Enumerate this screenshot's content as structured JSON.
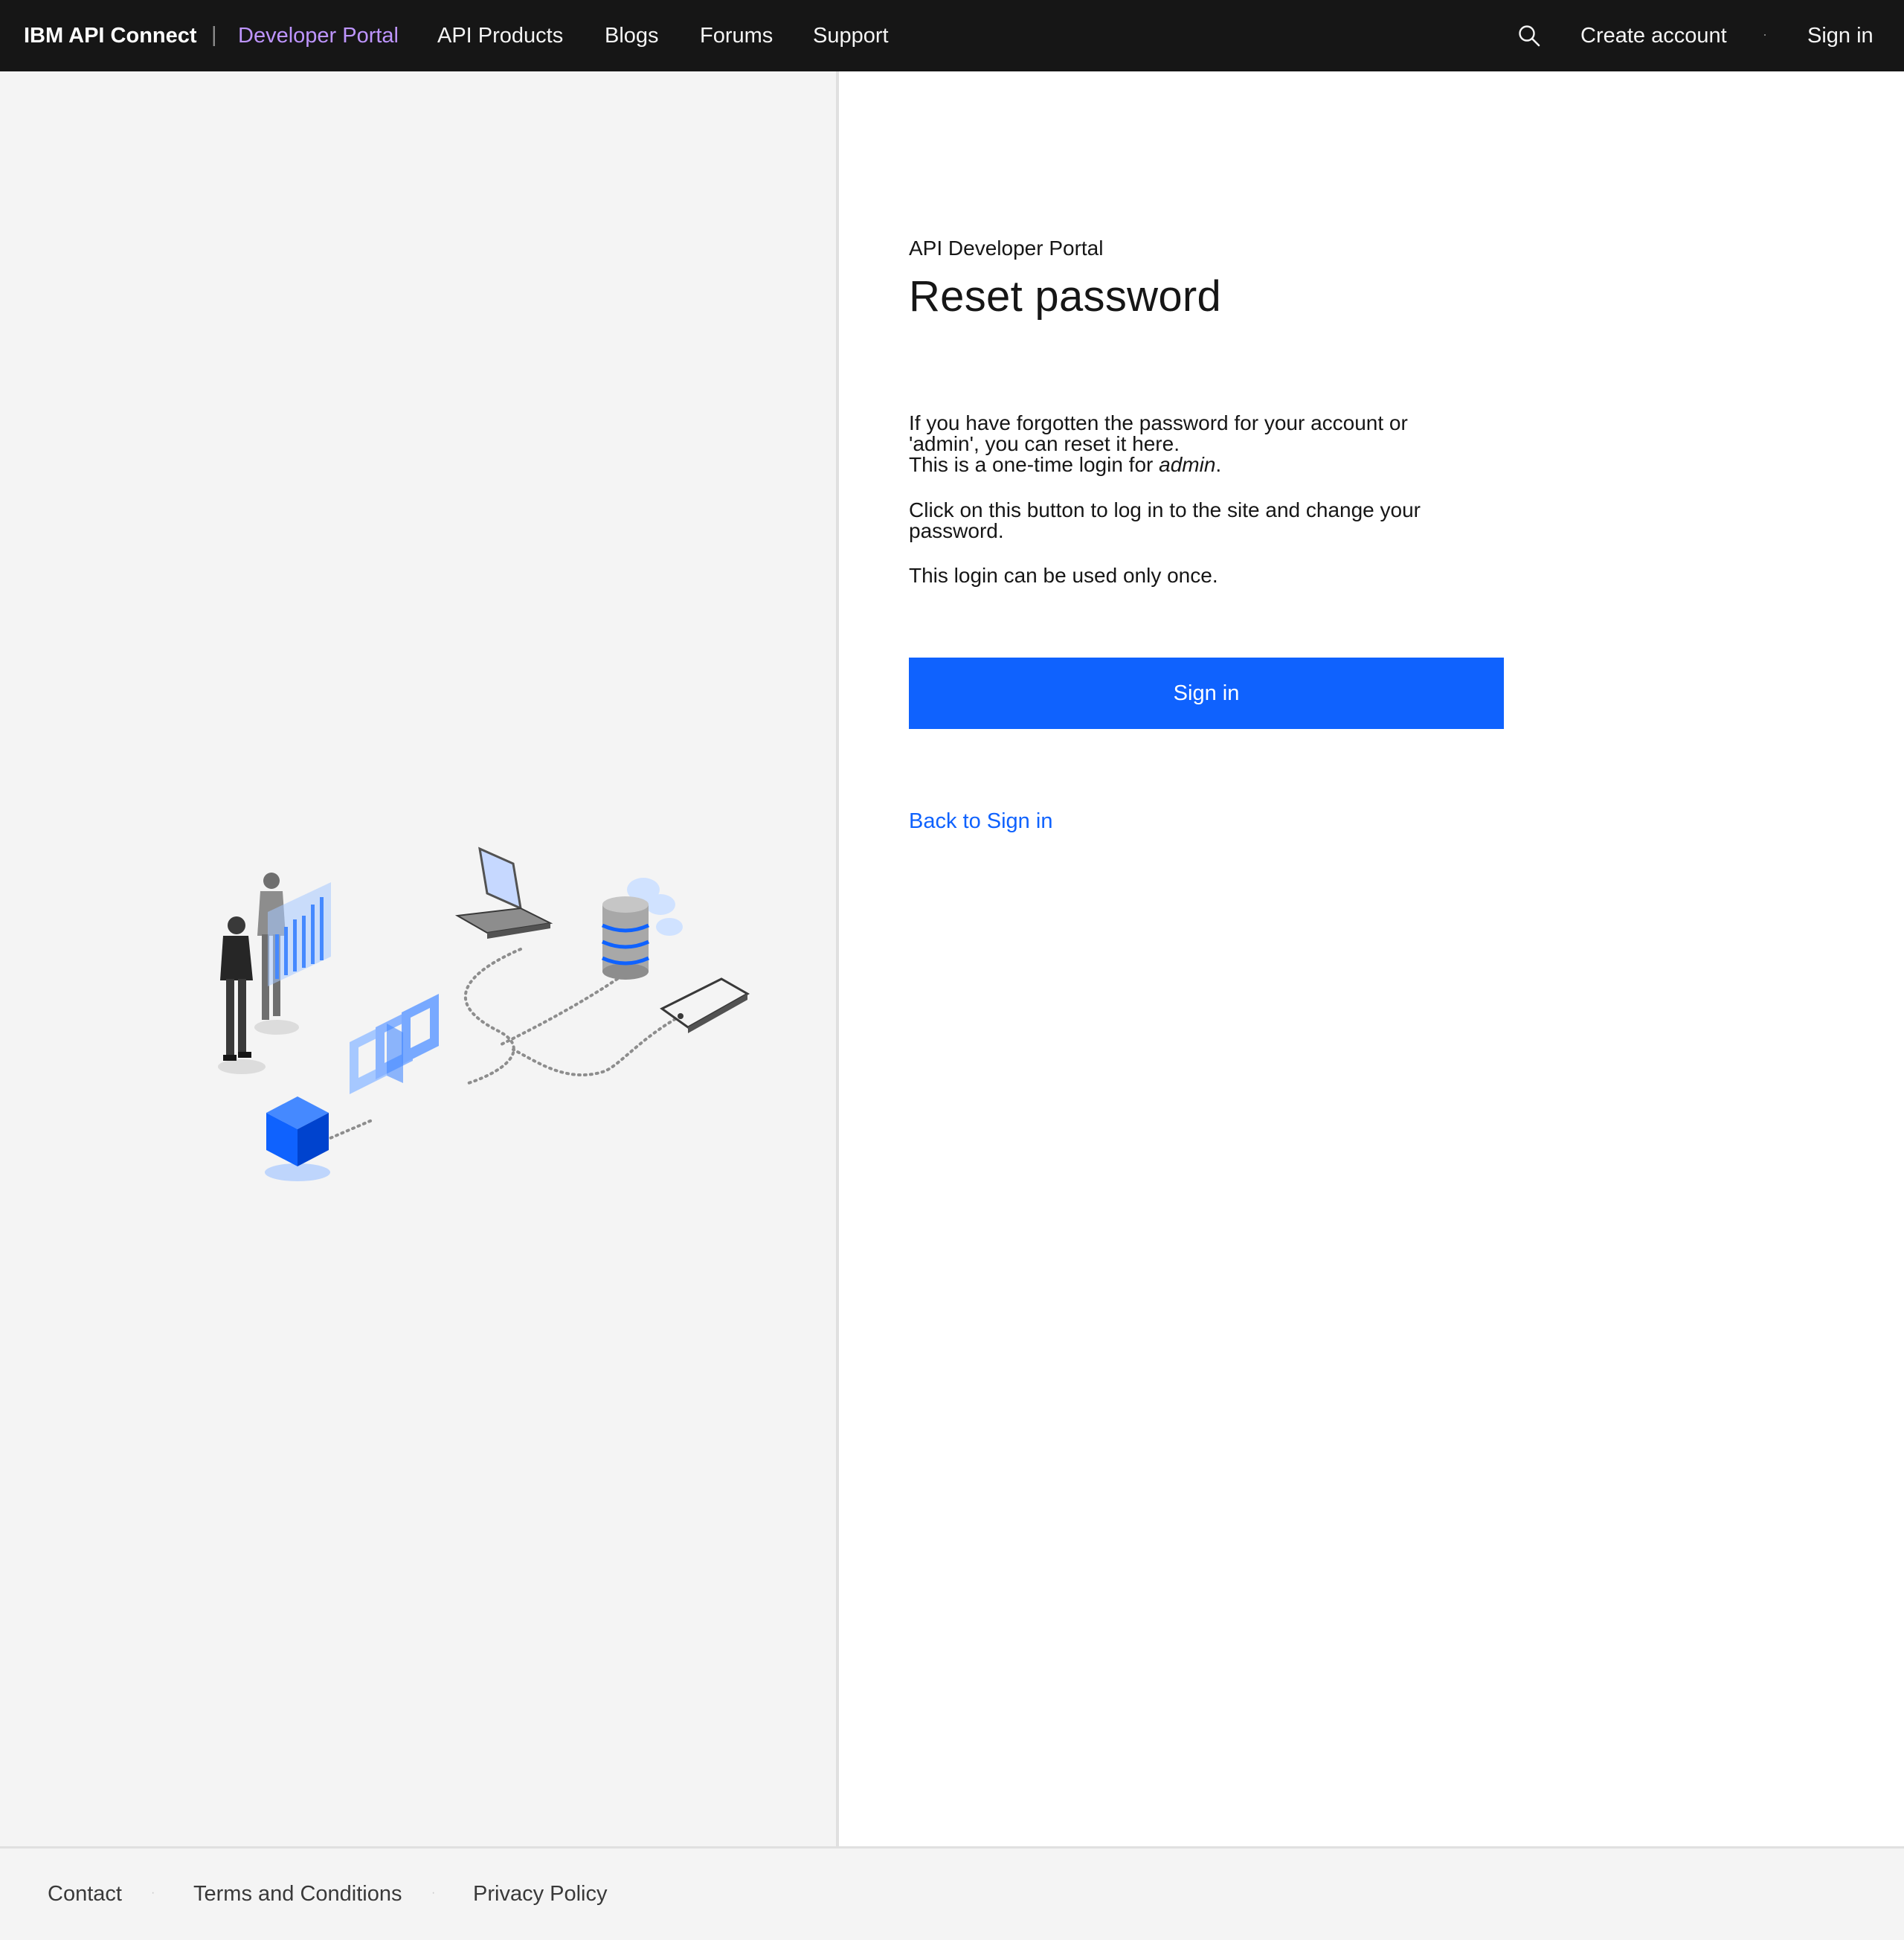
{
  "nav": {
    "brand": "IBM API Connect",
    "separator": "|",
    "links": [
      {
        "label": "Developer Portal",
        "active": true
      },
      {
        "label": "API Products"
      },
      {
        "label": "Blogs"
      },
      {
        "label": "Forums"
      },
      {
        "label": "Support"
      }
    ],
    "search_icon": "search-icon",
    "create_account": "Create account",
    "dot": "·",
    "sign_in": "Sign in"
  },
  "illustration": {
    "icons": [
      "people-icon",
      "bar-chart-icon",
      "laptop-icon",
      "database-icon",
      "cloud-icon",
      "phone-icon",
      "api-gateway-icon",
      "cube-icon"
    ]
  },
  "form": {
    "eyebrow": "API Developer Portal",
    "title": "Reset password",
    "para1_line1": "If you have forgotten the password for your account or",
    "para1_line2": "'admin', you can reset it here.",
    "para1_line3_prefix": "This is a one-time login for ",
    "para1_line3_user": "admin",
    "para1_line3_suffix": ".",
    "para2_line1": "Click on this button to log in to the site and change your",
    "para2_line2": "password.",
    "para3": "This login can be used only once.",
    "sign_in_button": "Sign in",
    "back_link": "Back to Sign in"
  },
  "footer": {
    "links": [
      "Contact",
      "Terms and Conditions",
      "Privacy Policy"
    ],
    "dot": "·"
  },
  "colors": {
    "nav_bg": "#161616",
    "nav_active": "#be95ff",
    "primary": "#0f62fe",
    "panel_bg": "#f4f4f4"
  }
}
